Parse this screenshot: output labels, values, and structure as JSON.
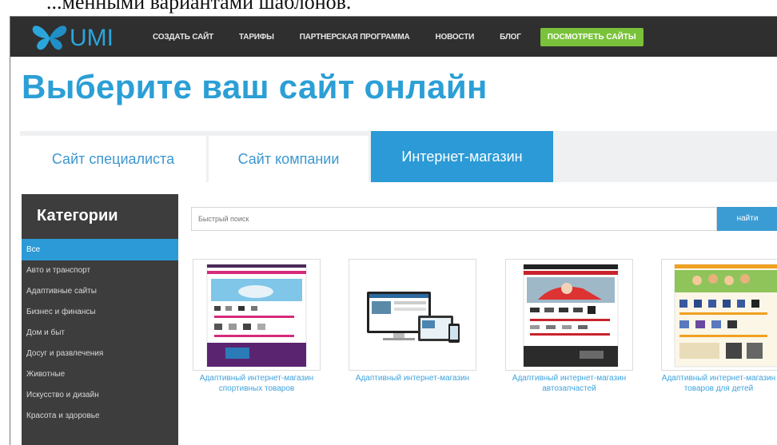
{
  "doc_caption": "...менными вариантами шаблонов.",
  "header": {
    "logo_text": "UMI",
    "nav": [
      "СОЗДАТЬ САЙТ",
      "ТАРИФЫ",
      "ПАРТНЕРСКАЯ ПРОГРАММА",
      "НОВОСТИ",
      "БЛОГ"
    ],
    "cta": "ПОСМОТРЕТЬ САЙТЫ"
  },
  "page_title": "Выберите ваш сайт онлайн",
  "tabs": [
    {
      "label": "Сайт специалиста",
      "active": false
    },
    {
      "label": "Сайт компании",
      "active": false
    },
    {
      "label": "Интернет-магазин",
      "active": true
    }
  ],
  "sidebar": {
    "title": "Категории",
    "items": [
      "Все",
      "Авто и транспорт",
      "Адаптивные сайты",
      "Бизнес и финансы",
      "Дом и быт",
      "Досуг и развлечения",
      "Животные",
      "Искусство и дизайн",
      "Красота и здоровье"
    ],
    "active_index": 0
  },
  "search": {
    "placeholder": "Быстрый поиск",
    "button": "найти"
  },
  "templates": [
    {
      "caption": "Адаптивный интернет-магазин спортивных товаров",
      "icon": "sports-shop-thumbnail"
    },
    {
      "caption": "Адаптивный интернет-магазин",
      "icon": "devices-thumbnail"
    },
    {
      "caption": "Адаптивный интернет-магазин автозапчастей",
      "icon": "auto-parts-thumbnail"
    },
    {
      "caption": "Адаптивный интернет-магазин товаров для детей",
      "icon": "kids-shop-thumbnail"
    }
  ],
  "colors": {
    "accent": "#2b9ad6",
    "header_bg": "#2f2f2f",
    "cta": "#79c23a",
    "sidebar_bg": "#3d3d3d"
  }
}
